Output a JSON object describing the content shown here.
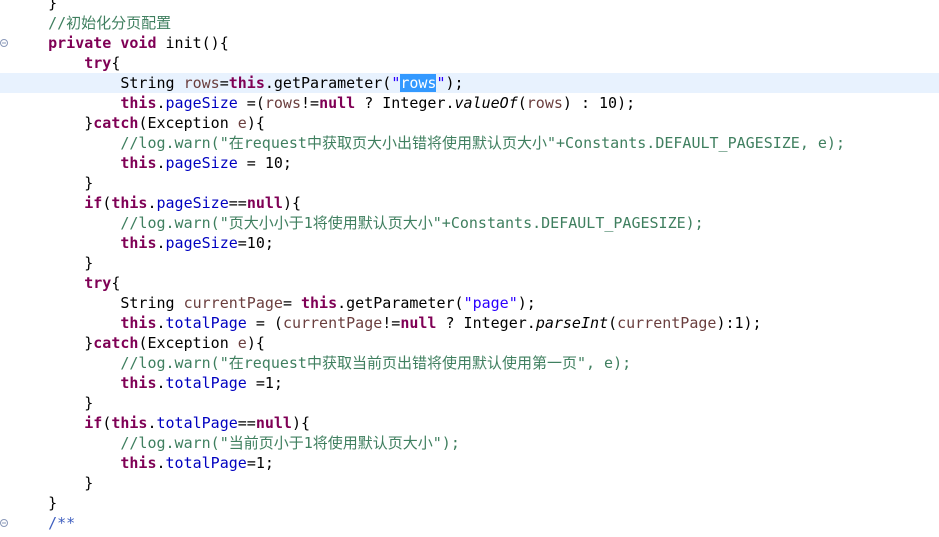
{
  "editor": {
    "lines": [
      [
        {
          "t": "    }",
          "c": "p"
        }
      ],
      [
        {
          "t": "    //初始化分页配置",
          "c": "cm"
        }
      ],
      [
        {
          "t": "    ",
          "c": "p"
        },
        {
          "t": "private",
          "c": "kw"
        },
        {
          "t": " ",
          "c": "p"
        },
        {
          "t": "void",
          "c": "kw"
        },
        {
          "t": " init(){",
          "c": "p"
        }
      ],
      [
        {
          "t": "        ",
          "c": "p"
        },
        {
          "t": "try",
          "c": "kw"
        },
        {
          "t": "{",
          "c": "p"
        }
      ],
      [
        {
          "t": "            String ",
          "c": "p"
        },
        {
          "t": "rows",
          "c": "var"
        },
        {
          "t": "=",
          "c": "p"
        },
        {
          "t": "this",
          "c": "kw"
        },
        {
          "t": ".getParameter(",
          "c": "p"
        },
        {
          "t": "\"",
          "c": "str"
        },
        {
          "t": "rows",
          "c": "sel"
        },
        {
          "t": "\"",
          "c": "str"
        },
        {
          "t": ");",
          "c": "p"
        }
      ],
      [
        {
          "t": "            ",
          "c": "p"
        },
        {
          "t": "this",
          "c": "kw"
        },
        {
          "t": ".",
          "c": "p"
        },
        {
          "t": "pageSize",
          "c": "fld"
        },
        {
          "t": " =(",
          "c": "p"
        },
        {
          "t": "rows",
          "c": "var"
        },
        {
          "t": "!=",
          "c": "p"
        },
        {
          "t": "null",
          "c": "kw"
        },
        {
          "t": " ? Integer.",
          "c": "p"
        },
        {
          "t": "valueOf",
          "c": "it"
        },
        {
          "t": "(",
          "c": "p"
        },
        {
          "t": "rows",
          "c": "var"
        },
        {
          "t": ") : 10);",
          "c": "p"
        }
      ],
      [
        {
          "t": "        }",
          "c": "p"
        },
        {
          "t": "catch",
          "c": "kw"
        },
        {
          "t": "(Exception ",
          "c": "p"
        },
        {
          "t": "e",
          "c": "var"
        },
        {
          "t": "){",
          "c": "p"
        }
      ],
      [
        {
          "t": "            //log.warn(\"在request中获取页大小出错将使用默认页大小\"+Constants.DEFAULT_PAGESIZE, e);",
          "c": "cm"
        }
      ],
      [
        {
          "t": "            ",
          "c": "p"
        },
        {
          "t": "this",
          "c": "kw"
        },
        {
          "t": ".",
          "c": "p"
        },
        {
          "t": "pageSize",
          "c": "fld"
        },
        {
          "t": " = 10;",
          "c": "p"
        }
      ],
      [
        {
          "t": "        }",
          "c": "p"
        }
      ],
      [
        {
          "t": "        ",
          "c": "p"
        },
        {
          "t": "if",
          "c": "kw"
        },
        {
          "t": "(",
          "c": "p"
        },
        {
          "t": "this",
          "c": "kw"
        },
        {
          "t": ".",
          "c": "p"
        },
        {
          "t": "pageSize",
          "c": "fld"
        },
        {
          "t": "==",
          "c": "p"
        },
        {
          "t": "null",
          "c": "kw"
        },
        {
          "t": "){",
          "c": "p"
        }
      ],
      [
        {
          "t": "            //log.warn(\"页大小小于1将使用默认页大小\"+Constants.DEFAULT_PAGESIZE);",
          "c": "cm"
        }
      ],
      [
        {
          "t": "            ",
          "c": "p"
        },
        {
          "t": "this",
          "c": "kw"
        },
        {
          "t": ".",
          "c": "p"
        },
        {
          "t": "pageSize",
          "c": "fld"
        },
        {
          "t": "=10;",
          "c": "p"
        }
      ],
      [
        {
          "t": "        }",
          "c": "p"
        }
      ],
      [
        {
          "t": "        ",
          "c": "p"
        },
        {
          "t": "try",
          "c": "kw"
        },
        {
          "t": "{",
          "c": "p"
        }
      ],
      [
        {
          "t": "            String ",
          "c": "p"
        },
        {
          "t": "currentPage",
          "c": "var"
        },
        {
          "t": "= ",
          "c": "p"
        },
        {
          "t": "this",
          "c": "kw"
        },
        {
          "t": ".getParameter(",
          "c": "p"
        },
        {
          "t": "\"page\"",
          "c": "str"
        },
        {
          "t": ");",
          "c": "p"
        }
      ],
      [
        {
          "t": "            ",
          "c": "p"
        },
        {
          "t": "this",
          "c": "kw"
        },
        {
          "t": ".",
          "c": "p"
        },
        {
          "t": "totalPage",
          "c": "fld"
        },
        {
          "t": " = (",
          "c": "p"
        },
        {
          "t": "currentPage",
          "c": "var"
        },
        {
          "t": "!=",
          "c": "p"
        },
        {
          "t": "null",
          "c": "kw"
        },
        {
          "t": " ? Integer.",
          "c": "p"
        },
        {
          "t": "parseInt",
          "c": "it"
        },
        {
          "t": "(",
          "c": "p"
        },
        {
          "t": "currentPage",
          "c": "var"
        },
        {
          "t": "):1);",
          "c": "p"
        }
      ],
      [
        {
          "t": "        }",
          "c": "p"
        },
        {
          "t": "catch",
          "c": "kw"
        },
        {
          "t": "(Exception ",
          "c": "p"
        },
        {
          "t": "e",
          "c": "var"
        },
        {
          "t": "){",
          "c": "p"
        }
      ],
      [
        {
          "t": "            //log.warn(\"在request中获取当前页出错将使用默认使用第一页\", e);",
          "c": "cm"
        }
      ],
      [
        {
          "t": "            ",
          "c": "p"
        },
        {
          "t": "this",
          "c": "kw"
        },
        {
          "t": ".",
          "c": "p"
        },
        {
          "t": "totalPage",
          "c": "fld"
        },
        {
          "t": " =1;",
          "c": "p"
        }
      ],
      [
        {
          "t": "        }",
          "c": "p"
        }
      ],
      [
        {
          "t": "        ",
          "c": "p"
        },
        {
          "t": "if",
          "c": "kw"
        },
        {
          "t": "(",
          "c": "p"
        },
        {
          "t": "this",
          "c": "kw"
        },
        {
          "t": ".",
          "c": "p"
        },
        {
          "t": "totalPage",
          "c": "fld"
        },
        {
          "t": "==",
          "c": "p"
        },
        {
          "t": "null",
          "c": "kw"
        },
        {
          "t": "){",
          "c": "p"
        }
      ],
      [
        {
          "t": "            //log.warn(\"当前页小于1将使用默认页大小\");",
          "c": "cm"
        }
      ],
      [
        {
          "t": "            ",
          "c": "p"
        },
        {
          "t": "this",
          "c": "kw"
        },
        {
          "t": ".",
          "c": "p"
        },
        {
          "t": "totalPage",
          "c": "fld"
        },
        {
          "t": "=1;",
          "c": "p"
        }
      ],
      [
        {
          "t": "        }",
          "c": "p"
        }
      ],
      [
        {
          "t": "    }",
          "c": "p"
        }
      ],
      [
        {
          "t": "    /**",
          "c": "jd"
        }
      ]
    ],
    "current_line": 4,
    "fold_markers": [
      2,
      26
    ],
    "colors": {
      "keyword": "#7f0055",
      "field": "#0000c0",
      "local_variable": "#6a3e3e",
      "string": "#2a00ff",
      "comment": "#3f7f5f",
      "javadoc": "#3f5fbf",
      "selection": "#3399ff",
      "current_line": "#e8f2fe"
    }
  }
}
